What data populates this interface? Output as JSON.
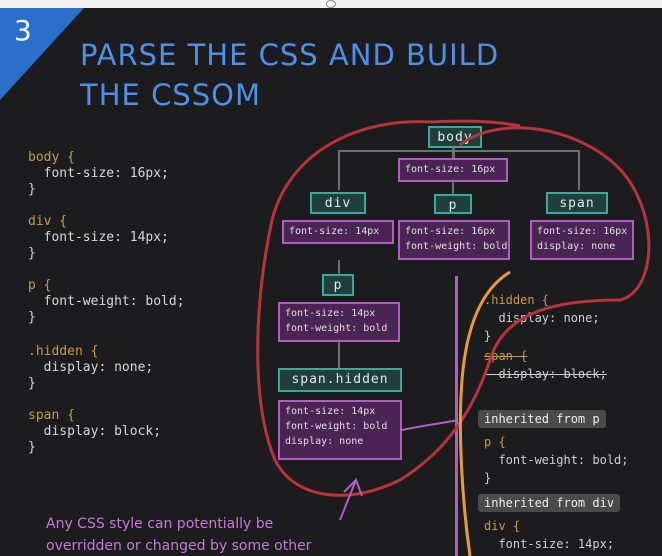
{
  "badge": "3",
  "title": [
    "PARSE THE CSS AND BUILD",
    "THE CSSOM"
  ],
  "css_rules": [
    {
      "selector": "body {",
      "decl": "  font-size: 16px;",
      "close": "}"
    },
    {
      "selector": "div {",
      "decl": "  font-size: 14px;",
      "close": "}"
    },
    {
      "selector": "p {",
      "decl": "  font-weight: bold;",
      "close": "}"
    },
    {
      "selector": ".hidden {",
      "decl": "  display: none;",
      "close": "}"
    },
    {
      "selector": "span {",
      "decl": "  display: block;",
      "close": "}"
    }
  ],
  "tree": {
    "body": {
      "label": "body",
      "styles": "font-size: 16px"
    },
    "div": {
      "label": "div",
      "styles": "font-size: 14px"
    },
    "p_top": {
      "label": "p",
      "styles": "font-size: 16px\nfont-weight: bold"
    },
    "span": {
      "label": "span",
      "styles": "font-size: 16px\ndisplay: none"
    },
    "p_child": {
      "label": "p",
      "styles": "font-size: 14px\nfont-weight: bold"
    },
    "span_hidden": {
      "label": "span.hidden",
      "styles": "font-size: 14px\nfont-weight: bold\ndisplay: none"
    }
  },
  "panel": {
    "hidden_sel": ".hidden {",
    "hidden_decl": "  display: none;",
    "hidden_close": "}",
    "span_sel": "span {",
    "span_decl": "  display: block;",
    "inherited_p": "inherited from p",
    "p_sel": "p {",
    "p_decl": "  font-weight: bold;",
    "p_close": "}",
    "inherited_div": "inherited from div",
    "div_sel": "div {",
    "div_decl": "  font-size: 14px;"
  },
  "note": [
    "Any CSS style can potentially be",
    "overridden or changed by some other"
  ]
}
